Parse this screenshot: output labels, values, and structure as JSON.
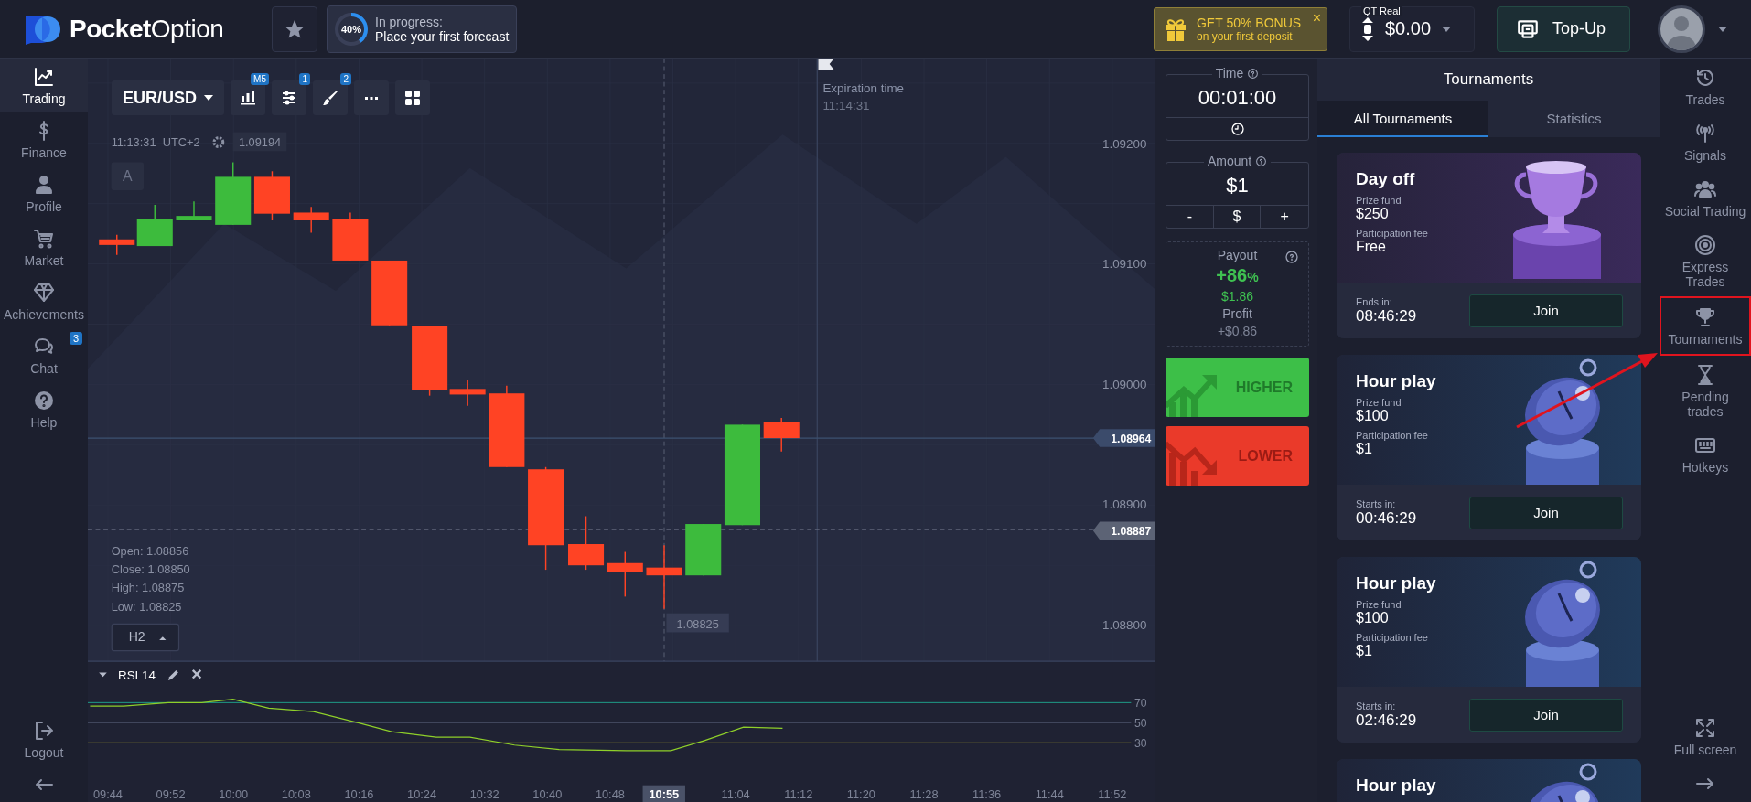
{
  "header": {
    "logo": "**Pocket**Option",
    "progress": {
      "percent": "40%",
      "level": 0.4,
      "title": "In progress:",
      "text": "Place your first forecast"
    },
    "bonus": {
      "title": "GET 50% BONUS",
      "subtitle": "on your first deposit",
      "close": "×"
    },
    "account": {
      "label": "QT Real",
      "balance": "$0.00"
    },
    "topup": "Top-Up"
  },
  "left_sidebar": {
    "items": [
      {
        "label": "Trading",
        "selected": true
      },
      {
        "label": "Finance",
        "selected": false
      },
      {
        "label": "Profile",
        "selected": false
      },
      {
        "label": "Market",
        "selected": false
      },
      {
        "label": "Achievements",
        "selected": false
      },
      {
        "label": "Chat",
        "selected": false,
        "badge": "3"
      },
      {
        "label": "Help",
        "selected": false
      }
    ],
    "logout": "Logout"
  },
  "chart": {
    "pair": "EUR/USD",
    "timeframe_badge": "M5",
    "indicators_badge": "1",
    "drawings_badge": "2",
    "clock": "11:13:31",
    "timezone": "UTC+2",
    "last_price": "1.09194",
    "auto_label": "A",
    "expiration": {
      "label": "Expiration time",
      "time": "11:14:31"
    },
    "price_ticks": [
      "1.09200",
      "1.09100",
      "1.09000",
      "1.08900",
      "1.08800"
    ],
    "current_price": "1.08964",
    "crosshair_price": "1.08887",
    "ohlc": [
      "Open: 1.08856",
      "Close: 1.08850",
      "High: 1.08875",
      "Low: 1.08825"
    ],
    "period": "H2",
    "crosshair_value": "1.08825",
    "rsi": {
      "title": "RSI 14",
      "levels": [
        "70",
        "50",
        "30"
      ]
    },
    "time_ticks": [
      {
        "label": "09:44",
        "highlighted": false
      },
      {
        "label": "09:52",
        "highlighted": false
      },
      {
        "label": "10:00",
        "highlighted": false
      },
      {
        "label": "10:08",
        "highlighted": false
      },
      {
        "label": "10:16",
        "highlighted": false
      },
      {
        "label": "10:24",
        "highlighted": false
      },
      {
        "label": "10:32",
        "highlighted": false
      },
      {
        "label": "10:40",
        "highlighted": false
      },
      {
        "label": "10:48",
        "highlighted": false
      },
      {
        "label": "10:55",
        "highlighted": true
      },
      {
        "label": "11:04",
        "highlighted": false
      },
      {
        "label": "11:12",
        "highlighted": false
      },
      {
        "label": "11:20",
        "highlighted": false
      },
      {
        "label": "11:28",
        "highlighted": false
      },
      {
        "label": "11:36",
        "highlighted": false
      },
      {
        "label": "11:44",
        "highlighted": false
      },
      {
        "label": "11:52",
        "highlighted": false
      }
    ]
  },
  "trade_panel": {
    "time": {
      "label": "Time",
      "value": "00:01:00"
    },
    "amount": {
      "label": "Amount",
      "value": "$1",
      "buttons": [
        "-",
        "$",
        "+"
      ]
    },
    "payout": {
      "label": "Payout",
      "percent": "+86",
      "percent_sign": "%",
      "value": "$1.86",
      "profit_label": "Profit",
      "profit": "+$0.86"
    },
    "higher": "HIGHER",
    "lower": "LOWER"
  },
  "tournaments": {
    "title": "Tournaments",
    "tabs": [
      {
        "label": "All Tournaments",
        "selected": true
      },
      {
        "label": "Statistics",
        "selected": false
      }
    ],
    "cards": [
      {
        "kind": "trophy",
        "name": "Day off",
        "prize_label": "Prize fund",
        "prize": "$250",
        "fee_label": "Participation fee",
        "fee": "Free",
        "timer_label": "Ends in:",
        "timer": "08:46:29",
        "button": "Join"
      },
      {
        "kind": "stopwatch",
        "name": "Hour play",
        "prize_label": "Prize fund",
        "prize": "$100",
        "fee_label": "Participation fee",
        "fee": "$1",
        "timer_label": "Starts in:",
        "timer": "00:46:29",
        "button": "Join"
      },
      {
        "kind": "stopwatch",
        "name": "Hour play",
        "prize_label": "Prize fund",
        "prize": "$100",
        "fee_label": "Participation fee",
        "fee": "$1",
        "timer_label": "Starts in:",
        "timer": "02:46:29",
        "button": "Join"
      },
      {
        "kind": "stopwatch",
        "name": "Hour play"
      }
    ]
  },
  "right_sidebar": {
    "items": [
      {
        "label": "Trades",
        "highlighted": false
      },
      {
        "label": "Signals",
        "highlighted": false
      },
      {
        "label": "Social Trading",
        "highlighted": false
      },
      {
        "label": "Express Trades",
        "highlighted": false
      },
      {
        "label": "Tournaments",
        "highlighted": true
      },
      {
        "label": "Pending trades",
        "highlighted": false
      },
      {
        "label": "Hotkeys",
        "highlighted": false
      }
    ],
    "fullscreen": "Full screen"
  }
}
